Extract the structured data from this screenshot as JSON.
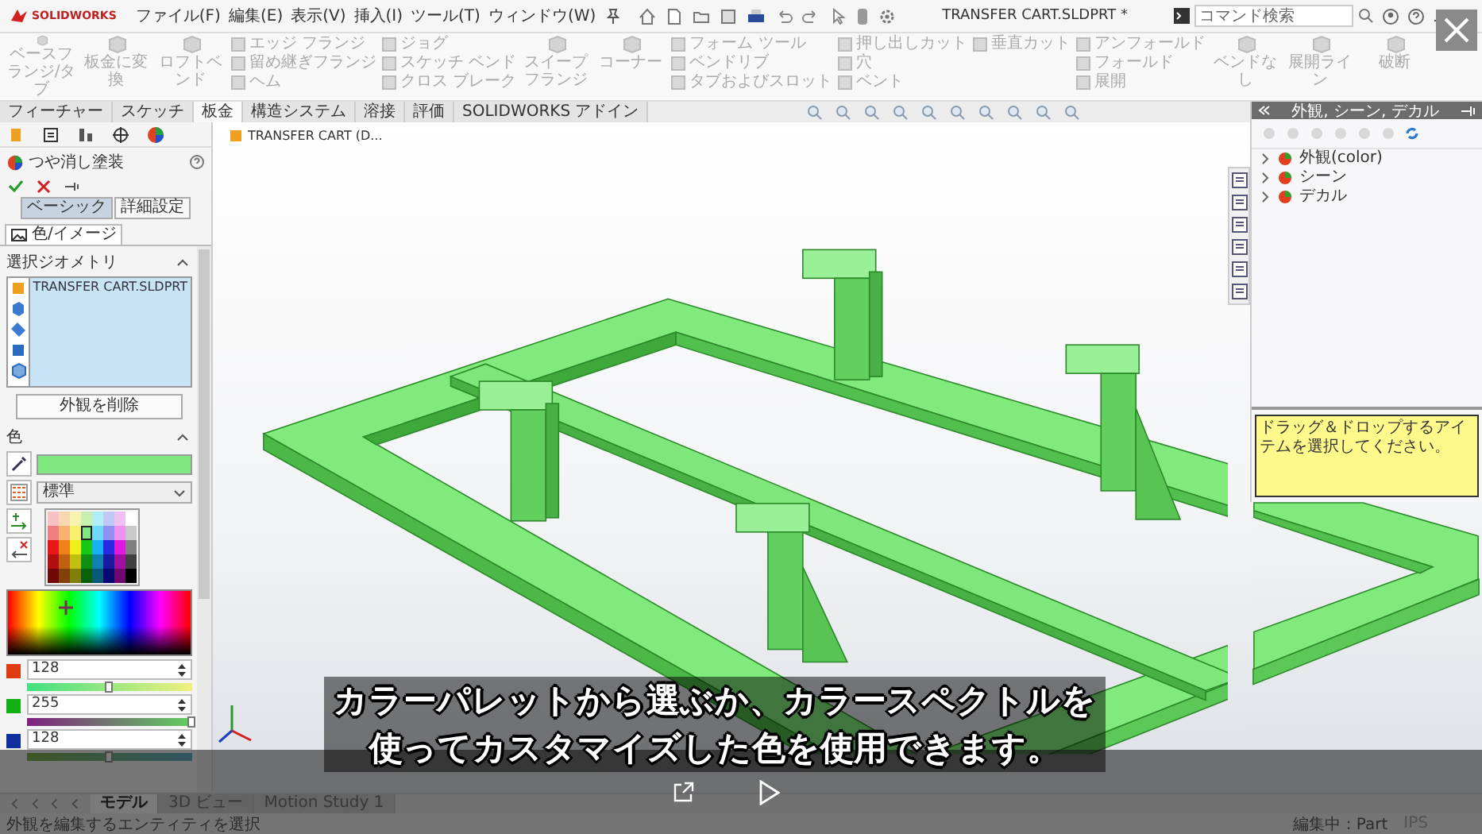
{
  "title_bar": {
    "logo": "SOLIDWORKS",
    "menus": [
      "ファイル(F)",
      "編集(E)",
      "表示(V)",
      "挿入(I)",
      "ツール(T)",
      "ウィンドウ(W)"
    ],
    "document_title": "TRANSFER CART.SLDPRT *",
    "search": {
      "placeholder": "コマンド検索"
    }
  },
  "ribbon": {
    "groups": [
      {
        "kind": "large",
        "items": [
          "ベースフランジ/タブ",
          "板金に変換",
          "ロフトベンド"
        ]
      },
      {
        "kind": "small",
        "items": [
          "エッジ フランジ",
          "留め継ぎフランジ",
          "ヘム"
        ]
      },
      {
        "kind": "small",
        "items": [
          "ジョグ",
          "スケッチ ベンド",
          "クロス ブレーク"
        ]
      },
      {
        "kind": "large",
        "items": [
          "スイープフランジ",
          "コーナー"
        ]
      },
      {
        "kind": "small",
        "items": [
          "フォーム ツール",
          "ベンドリブ",
          "タブおよびスロット"
        ]
      },
      {
        "kind": "small",
        "items": [
          "押し出しカット",
          "穴",
          "ベント"
        ]
      },
      {
        "kind": "small",
        "items": [
          "垂直カット"
        ]
      },
      {
        "kind": "small",
        "items": [
          "アンフォールド",
          "フォールド",
          "展開"
        ]
      },
      {
        "kind": "large",
        "items": [
          "ベンドなし",
          "展開ライン",
          "破断"
        ]
      }
    ]
  },
  "tabs": [
    {
      "label": "フィーチャー",
      "selected": false
    },
    {
      "label": "スケッチ",
      "selected": false
    },
    {
      "label": "板金",
      "selected": true
    },
    {
      "label": "構造システム",
      "selected": false
    },
    {
      "label": "溶接",
      "selected": false
    },
    {
      "label": "評価",
      "selected": false
    },
    {
      "label": "SOLIDWORKS アドイン",
      "selected": false
    }
  ],
  "property_manager": {
    "title": "つや消し塗装",
    "mode_buttons": [
      {
        "label": "ベーシック",
        "selected": true
      },
      {
        "label": "詳細設定",
        "selected": false
      }
    ],
    "tab": "色/イメージ",
    "geometry": {
      "heading": "選択ジオメトリ",
      "entries": [
        "TRANSFER CART.SLDPRT"
      ],
      "remove_button": "外観を削除"
    },
    "color": {
      "heading": "色",
      "palette_name": "標準",
      "palette": [
        {
          "color": "#f4c2c2",
          "selected": false
        },
        {
          "color": "#f8d8b0",
          "selected": false
        },
        {
          "color": "#f8f4b0",
          "selected": false
        },
        {
          "color": "#c8f0b0",
          "selected": false
        },
        {
          "color": "#b0eef8",
          "selected": false
        },
        {
          "color": "#c0c8f8",
          "selected": false
        },
        {
          "color": "#f0c0f0",
          "selected": false
        },
        {
          "color": "#ffffff",
          "selected": false
        },
        {
          "color": "#f08080",
          "selected": false
        },
        {
          "color": "#f8b070",
          "selected": false
        },
        {
          "color": "#f8f070",
          "selected": false
        },
        {
          "color": "#80e880",
          "selected": true
        },
        {
          "color": "#70d8f8",
          "selected": false
        },
        {
          "color": "#9090f0",
          "selected": false
        },
        {
          "color": "#f090f0",
          "selected": false
        },
        {
          "color": "#c8c8c8",
          "selected": false
        },
        {
          "color": "#e81818",
          "selected": false
        },
        {
          "color": "#f08018",
          "selected": false
        },
        {
          "color": "#f0f018",
          "selected": false
        },
        {
          "color": "#18c818",
          "selected": false
        },
        {
          "color": "#18b0f0",
          "selected": false
        },
        {
          "color": "#2828e0",
          "selected": false
        },
        {
          "color": "#e018e0",
          "selected": false
        },
        {
          "color": "#808080",
          "selected": false
        },
        {
          "color": "#b01010",
          "selected": false
        },
        {
          "color": "#c06010",
          "selected": false
        },
        {
          "color": "#c0c010",
          "selected": false
        },
        {
          "color": "#109010",
          "selected": false
        },
        {
          "color": "#1080b0",
          "selected": false
        },
        {
          "color": "#1818a0",
          "selected": false
        },
        {
          "color": "#a010a0",
          "selected": false
        },
        {
          "color": "#404040",
          "selected": false
        },
        {
          "color": "#700808",
          "selected": false
        },
        {
          "color": "#804008",
          "selected": false
        },
        {
          "color": "#808008",
          "selected": false
        },
        {
          "color": "#086008",
          "selected": false
        },
        {
          "color": "#085878",
          "selected": false
        },
        {
          "color": "#080870",
          "selected": false
        },
        {
          "color": "#700870",
          "selected": false
        },
        {
          "color": "#000000",
          "selected": false
        }
      ],
      "channels": [
        {
          "value": "128",
          "level": 0.5,
          "color": "#e03a10"
        },
        {
          "value": "255",
          "level": 1.0,
          "color": "#10b010"
        },
        {
          "value": "128",
          "level": 0.5,
          "color": "#1030a0"
        }
      ]
    }
  },
  "viewport": {
    "breadcrumb": "TRANSFER CART (D..."
  },
  "task_pane": {
    "title": "外観, シーン, デカル",
    "items": [
      {
        "label": "外観(color)",
        "expanded": false
      },
      {
        "label": "シーン",
        "expanded": false
      },
      {
        "label": "デカル",
        "expanded": false
      }
    ],
    "hint": "ドラッグ＆ドロップするアイテムを選択してください。"
  },
  "bottom_tabs": [
    {
      "label": "モデル",
      "selected": true
    },
    {
      "label": "3D ビュー",
      "selected": false
    },
    {
      "label": "Motion Study 1",
      "selected": false
    }
  ],
  "status_bar": {
    "message": "外観を編集するエンティティを選択",
    "editing": "編集中 : Part",
    "units": "IPS"
  },
  "video": {
    "subtitle": [
      "カラーパレットから選ぶか、カラースペクトルを",
      "使ってカスタマイズした色を使用できます。"
    ]
  }
}
